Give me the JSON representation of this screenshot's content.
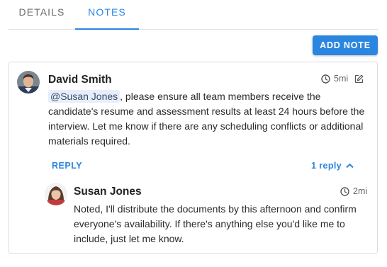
{
  "tabs": [
    {
      "label": "DETAILS",
      "active": false
    },
    {
      "label": "NOTES",
      "active": true
    }
  ],
  "toolbar": {
    "add_note_label": "ADD NOTE"
  },
  "note": {
    "author": "David Smith",
    "time": "5mi",
    "mention": "@Susan Jones",
    "text": ", please ensure all team members receive the candidate's resume and assessment results at least 24 hours before the interview. Let me know if there are any scheduling conflicts or additional materials required.",
    "reply_label": "REPLY",
    "replies_count": "1 reply",
    "icons": {
      "time": "clock-icon",
      "edit": "edit-icon",
      "toggle": "chevron-up-icon"
    }
  },
  "reply": {
    "author": "Susan Jones",
    "time": "2mi",
    "text": "Noted, I'll distribute the documents by this afternoon and confirm everyone's availability. If there's anything else you'd like me to include, just let me know."
  },
  "colors": {
    "accent": "#2b86e0",
    "mention_bg": "#e6eefb"
  }
}
